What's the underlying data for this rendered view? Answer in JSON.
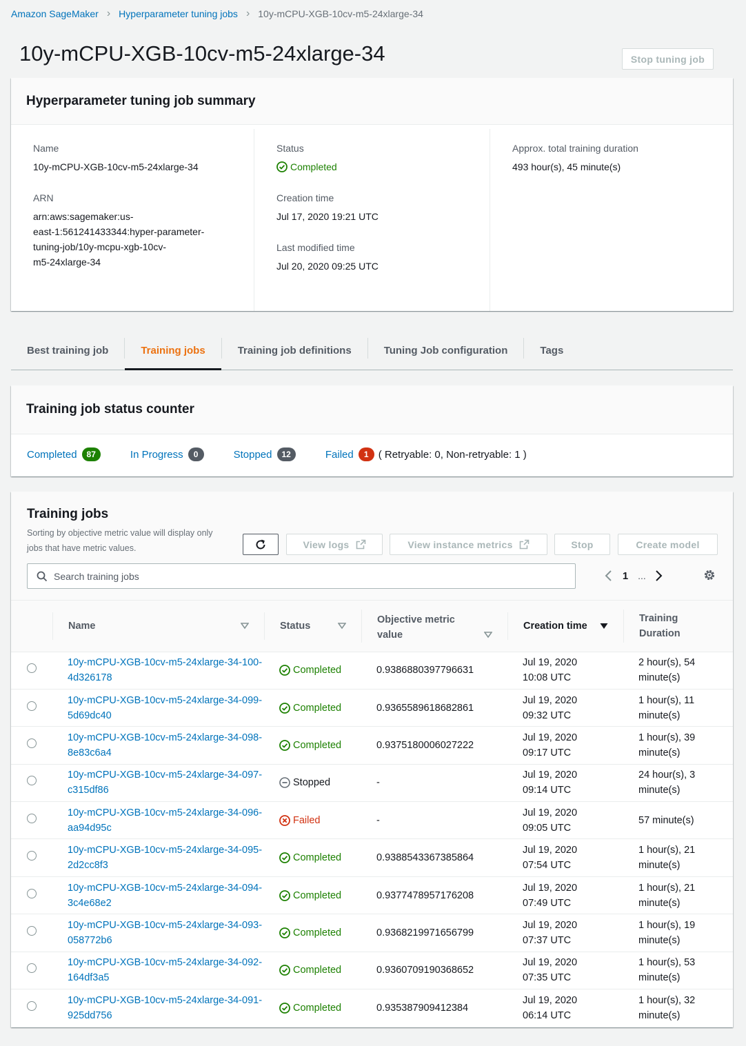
{
  "breadcrumb": {
    "items": [
      "Amazon SageMaker",
      "Hyperparameter tuning jobs"
    ],
    "current": "10y-mCPU-XGB-10cv-m5-24xlarge-34"
  },
  "page": {
    "title": "10y-mCPU-XGB-10cv-m5-24xlarge-34",
    "stop_label": "Stop tuning job"
  },
  "summary": {
    "title": "Hyperparameter tuning job summary",
    "name_label": "Name",
    "name_value": "10y-mCPU-XGB-10cv-m5-24xlarge-34",
    "arn_label": "ARN",
    "arn_lines": [
      "arn:aws:sagemaker:us-",
      "east-1:561241433344:hyper-parameter-",
      "tuning-job/10y-mcpu-xgb-10cv-",
      "m5-24xlarge-34"
    ],
    "status_label": "Status",
    "status_value": "Completed",
    "creation_label": "Creation time",
    "creation_value": "Jul 17, 2020 19:21 UTC",
    "modified_label": "Last modified time",
    "modified_value": "Jul 20, 2020 09:25 UTC",
    "duration_label": "Approx. total training duration",
    "duration_value": "493 hour(s), 45 minute(s)"
  },
  "tabs": [
    "Best training job",
    "Training jobs",
    "Training job definitions",
    "Tuning Job configuration",
    "Tags"
  ],
  "counter": {
    "title": "Training job status counter",
    "completed_label": "Completed",
    "completed_count": "87",
    "inprogress_label": "In Progress",
    "inprogress_count": "0",
    "stopped_label": "Stopped",
    "stopped_count": "12",
    "failed_label": "Failed",
    "failed_count": "1",
    "retry_text": "( Retryable: 0, Non-retryable: 1 )"
  },
  "jobs": {
    "title": "Training jobs",
    "desc": "Sorting by objective metric value will display only jobs that have metric values.",
    "view_logs": "View logs",
    "view_metrics": "View instance metrics",
    "stop": "Stop",
    "create_model": "Create model",
    "search_placeholder": "Search training jobs",
    "page": "1",
    "dots": "...",
    "columns": {
      "name": "Name",
      "status": "Status",
      "metric": "Objective metric value",
      "creation": "Creation time",
      "duration": "Training Duration"
    },
    "rows": [
      {
        "name": "10y-mCPU-XGB-10cv-m5-24xlarge-34-100-4d326178",
        "status": "Completed",
        "metric": "0.9386880397796631",
        "creation": "Jul 19, 2020 10:08 UTC",
        "duration": "2 hour(s), 54 minute(s)"
      },
      {
        "name": "10y-mCPU-XGB-10cv-m5-24xlarge-34-099-5d69dc40",
        "status": "Completed",
        "metric": "0.9365589618682861",
        "creation": "Jul 19, 2020 09:32 UTC",
        "duration": "1 hour(s), 11 minute(s)"
      },
      {
        "name": "10y-mCPU-XGB-10cv-m5-24xlarge-34-098-8e83c6a4",
        "status": "Completed",
        "metric": "0.9375180006027222",
        "creation": "Jul 19, 2020 09:17 UTC",
        "duration": "1 hour(s), 39 minute(s)"
      },
      {
        "name": "10y-mCPU-XGB-10cv-m5-24xlarge-34-097-c315df86",
        "status": "Stopped",
        "metric": "-",
        "creation": "Jul 19, 2020 09:14 UTC",
        "duration": "24 hour(s), 3 minute(s)"
      },
      {
        "name": "10y-mCPU-XGB-10cv-m5-24xlarge-34-096-aa94d95c",
        "status": "Failed",
        "metric": "-",
        "creation": "Jul 19, 2020 09:05 UTC",
        "duration": "57 minute(s)"
      },
      {
        "name": "10y-mCPU-XGB-10cv-m5-24xlarge-34-095-2d2cc8f3",
        "status": "Completed",
        "metric": "0.9388543367385864",
        "creation": "Jul 19, 2020 07:54 UTC",
        "duration": "1 hour(s), 21 minute(s)"
      },
      {
        "name": "10y-mCPU-XGB-10cv-m5-24xlarge-34-094-3c4e68e2",
        "status": "Completed",
        "metric": "0.9377478957176208",
        "creation": "Jul 19, 2020 07:49 UTC",
        "duration": "1 hour(s), 21 minute(s)"
      },
      {
        "name": "10y-mCPU-XGB-10cv-m5-24xlarge-34-093-058772b6",
        "status": "Completed",
        "metric": "0.9368219971656799",
        "creation": "Jul 19, 2020 07:37 UTC",
        "duration": "1 hour(s), 19 minute(s)"
      },
      {
        "name": "10y-mCPU-XGB-10cv-m5-24xlarge-34-092-164df3a5",
        "status": "Completed",
        "metric": "0.9360709190368652",
        "creation": "Jul 19, 2020 07:35 UTC",
        "duration": "1 hour(s), 53 minute(s)"
      },
      {
        "name": "10y-mCPU-XGB-10cv-m5-24xlarge-34-091-925dd756",
        "status": "Completed",
        "metric": "0.935387909412384",
        "creation": "Jul 19, 2020 06:14 UTC",
        "duration": "1 hour(s), 32 minute(s)"
      }
    ]
  },
  "colors": {
    "link": "#0073bb",
    "success": "#1d8102",
    "error": "#d13212",
    "active_tab": "#ec7211"
  }
}
